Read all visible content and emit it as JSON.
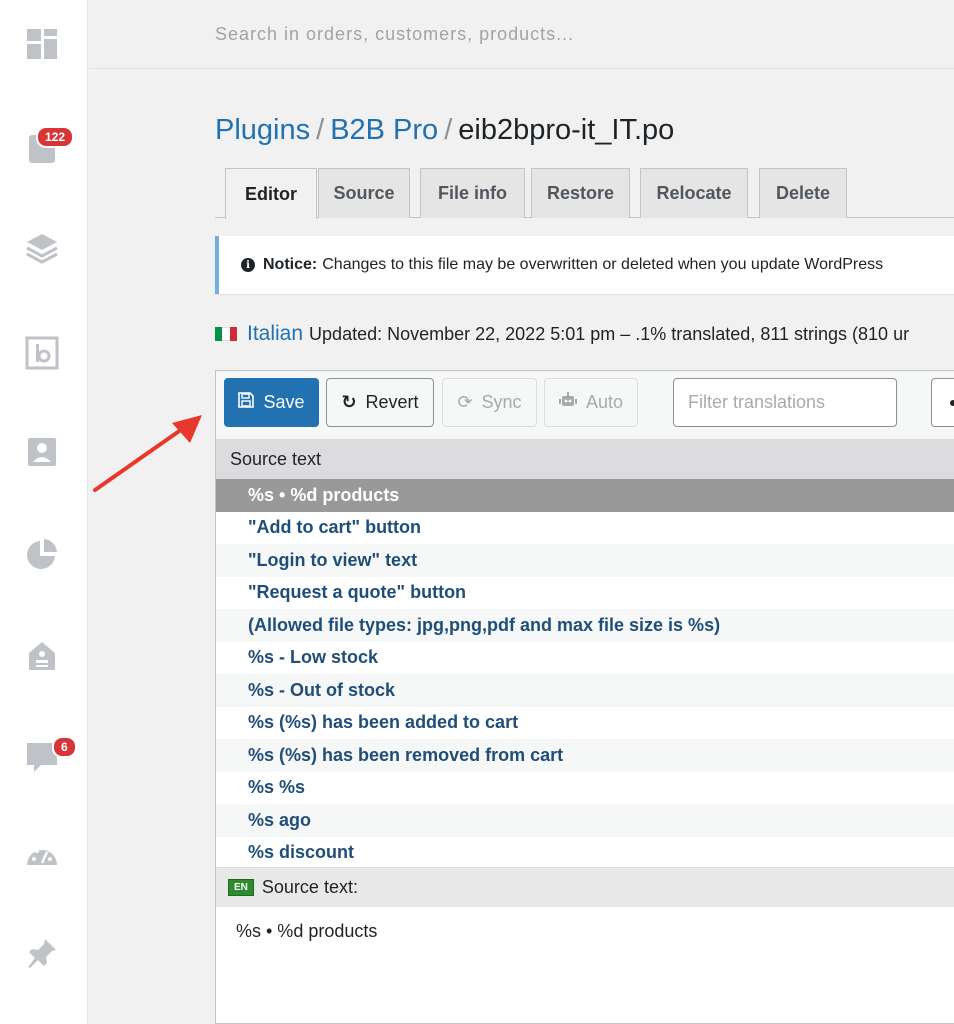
{
  "sidebar": {
    "orders_badge": "122",
    "messages_badge": "6",
    "icons": [
      "dashboard-icon",
      "orders-icon",
      "layers-icon",
      "b2b-icon",
      "contacts-icon",
      "reports-icon",
      "store-icon",
      "messages-icon",
      "speedometer-icon",
      "pin-icon"
    ]
  },
  "search": {
    "placeholder": "Search in orders, customers, products..."
  },
  "breadcrumb": {
    "plugins": "Plugins",
    "plugin": "B2B Pro",
    "file": "eib2bpro-it_IT.po",
    "separator": "/"
  },
  "tabs": [
    {
      "label": "Editor"
    },
    {
      "label": "Source"
    },
    {
      "label": "File info"
    },
    {
      "label": "Restore"
    },
    {
      "label": "Relocate"
    },
    {
      "label": "Delete"
    }
  ],
  "notice": {
    "label": "Notice:",
    "text": "Changes to this file may be overwritten or deleted when you update WordPress",
    "icon": "i"
  },
  "locale": {
    "language": "Italian",
    "details": "Updated: November 22, 2022 5:01 pm – .1% translated, 811 strings (810 ur"
  },
  "toolbar": {
    "save_label": "Save",
    "revert_label": "Revert",
    "sync_label": "Sync",
    "auto_label": "Auto",
    "filter_placeholder": "Filter translations"
  },
  "list": {
    "header": "Source text",
    "rows": [
      "%s • %d products",
      "\"Add to cart\" button",
      "\"Login to view\" text",
      "\"Request a quote\" button",
      "(Allowed file types: jpg,png,pdf and max file size is %s)",
      "%s - Low stock",
      "%s - Out of stock",
      "%s (%s) has been added to cart",
      "%s (%s) has been removed from cart",
      "%s %s",
      "%s ago",
      "%s discount"
    ]
  },
  "source_panel": {
    "lang_tag": "EN",
    "label": "Source text:",
    "text": "%s  • %d products"
  },
  "colors": {
    "accent": "#2271b1",
    "badge": "#d63638",
    "arrow": "#e8382c",
    "selected_row": "#999999"
  }
}
